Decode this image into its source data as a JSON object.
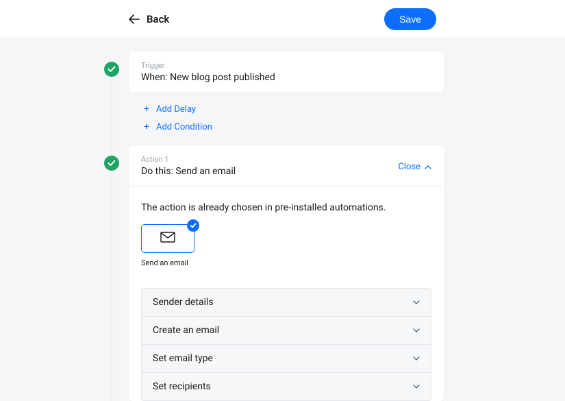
{
  "header": {
    "back_label": "Back",
    "save_label": "Save"
  },
  "trigger": {
    "badge": "Trigger",
    "title": "When: New blog post published"
  },
  "add_actions": {
    "delay": "Add Delay",
    "condition": "Add Condition"
  },
  "action": {
    "badge": "Action 1",
    "title": "Do this: Send an email",
    "close_label": "Close",
    "body_note": "The action is already chosen in pre-installed automations.",
    "tile_label": "Send an email",
    "sections": {
      "sender": "Sender details",
      "create": "Create an email",
      "type": "Set email type",
      "recipients": "Set recipients"
    }
  }
}
